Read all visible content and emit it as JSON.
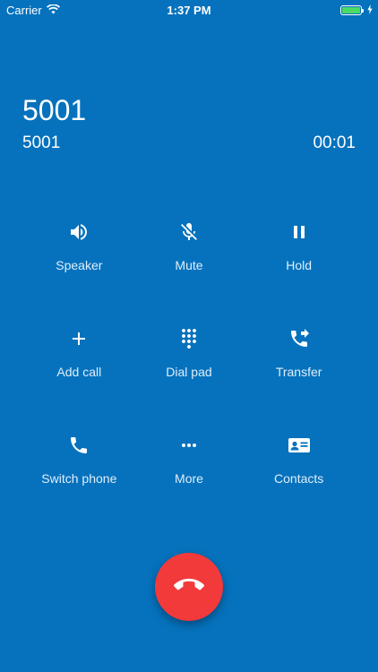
{
  "status_bar": {
    "carrier": "Carrier",
    "time": "1:37 PM",
    "battery_level": 1.0,
    "battery_color": "#4cd964"
  },
  "call": {
    "name": "5001",
    "number": "5001",
    "duration": "00:01"
  },
  "controls": {
    "speaker": {
      "label": "Speaker",
      "icon": "speaker-icon"
    },
    "mute": {
      "label": "Mute",
      "icon": "mic-off-icon"
    },
    "hold": {
      "label": "Hold",
      "icon": "pause-icon"
    },
    "add_call": {
      "label": "Add call",
      "icon": "plus-icon"
    },
    "dial_pad": {
      "label": "Dial pad",
      "icon": "dialpad-icon"
    },
    "transfer": {
      "label": "Transfer",
      "icon": "phone-forward-icon"
    },
    "switch_phone": {
      "label": "Switch phone",
      "icon": "phone-icon"
    },
    "more": {
      "label": "More",
      "icon": "more-horizontal-icon"
    },
    "contacts": {
      "label": "Contacts",
      "icon": "contact-card-icon"
    }
  },
  "end_call": {
    "icon": "call-end-icon",
    "color": "#f23a3a"
  },
  "theme": {
    "background": "#0672bd"
  }
}
